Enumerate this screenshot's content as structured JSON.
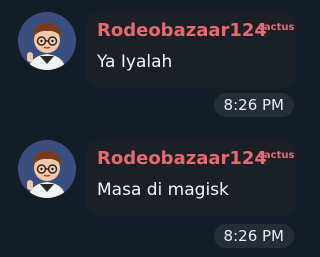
{
  "messages": [
    {
      "sender": "Rodeobazaar124",
      "tag": "cactus",
      "text": "Ya Iyalah",
      "time": "8:26 PM",
      "avatar": "cartoon-boy-avatar"
    },
    {
      "sender": "Rodeobazaar124",
      "tag": "cactus",
      "text": "Masa di magisk",
      "time": "8:26 PM",
      "avatar": "cartoon-boy-avatar"
    }
  ],
  "colors": {
    "background": "#131d27",
    "bubble": "#1b2027",
    "sender": "#e76a72",
    "text": "#f2f4f6",
    "time_pill": "#252d37"
  }
}
